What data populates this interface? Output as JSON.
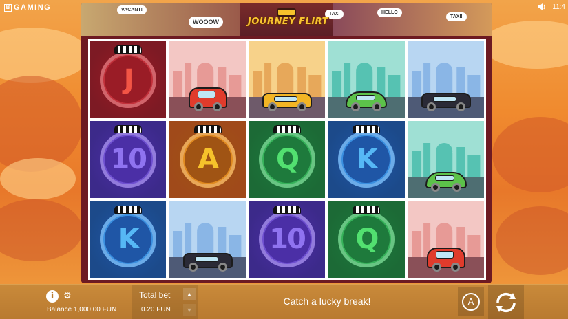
{
  "brand": {
    "name": "GAMING",
    "mark": "B"
  },
  "status": {
    "time": "11:4"
  },
  "game": {
    "title": "JOURNEY FLIRT"
  },
  "header_bubbles": [
    "VACANT!",
    "WOOOW",
    "TAXI",
    "HELLO",
    "TAXI!"
  ],
  "reels": [
    [
      {
        "kind": "letter",
        "label": "J",
        "theme": "red"
      },
      {
        "kind": "vehicle",
        "label": "tuk-tuk",
        "theme": "pink"
      },
      {
        "kind": "vehicle",
        "label": "yellow-cab",
        "theme": "orange"
      },
      {
        "kind": "vehicle",
        "label": "green-beetle",
        "theme": "teal"
      },
      {
        "kind": "vehicle",
        "label": "black-cab",
        "theme": "blue"
      }
    ],
    [
      {
        "kind": "letter",
        "label": "10",
        "theme": "purple"
      },
      {
        "kind": "letter",
        "label": "A",
        "theme": "orange"
      },
      {
        "kind": "letter",
        "label": "Q",
        "theme": "green"
      },
      {
        "kind": "letter",
        "label": "K",
        "theme": "blue"
      },
      {
        "kind": "vehicle",
        "label": "green-beetle",
        "theme": "teal"
      }
    ],
    [
      {
        "kind": "letter",
        "label": "K",
        "theme": "blue"
      },
      {
        "kind": "vehicle",
        "label": "black-cab",
        "theme": "blue"
      },
      {
        "kind": "letter",
        "label": "10",
        "theme": "purple"
      },
      {
        "kind": "letter",
        "label": "Q",
        "theme": "green"
      },
      {
        "kind": "vehicle",
        "label": "tuk-tuk",
        "theme": "pink"
      }
    ]
  ],
  "themes": {
    "red": {
      "bg": "#7d1a24",
      "ring": "#c2303a",
      "inner": "#9a1c26",
      "glyph": "#f35545"
    },
    "purple": {
      "bg": "#3c2a8a",
      "ring": "#6e4fd0",
      "inner": "#4b2fa6",
      "glyph": "#8f73f0"
    },
    "orange": {
      "bg": "#a04a1a",
      "ring": "#e08a20",
      "inner": "#a05414",
      "glyph": "#f6c22b"
    },
    "green": {
      "bg": "#1c6a36",
      "ring": "#36b25a",
      "inner": "#1e7a3c",
      "glyph": "#52e070"
    },
    "blue": {
      "bg": "#1c4a8a",
      "ring": "#3a8fe0",
      "inner": "#1f56a6",
      "glyph": "#56b8f5"
    }
  },
  "vehicle_scenes": {
    "pink": {
      "sky": "#f3c7c4",
      "city": "#e79a96",
      "road": "#8a5058",
      "car": "#e03b2c",
      "roof": "#f6c22b"
    },
    "orange": {
      "sky": "#f7d28a",
      "city": "#e7a85a",
      "road": "#6e5a6a",
      "car": "#f2b524",
      "roof": "#f2b524"
    },
    "teal": {
      "sky": "#9fe0d4",
      "city": "#56c2b2",
      "road": "#4e6e72",
      "car": "#5cc24a",
      "roof": "#5cc24a"
    },
    "blue": {
      "sky": "#b8d6f2",
      "city": "#8ab6e6",
      "road": "#4e5a76",
      "car": "#2a2a36",
      "roof": "#2a2a36"
    }
  },
  "bottom": {
    "info_label": "i",
    "gear_label": "⚙",
    "balance_label": "Balance",
    "balance_value": "1,000.00",
    "balance_currency": "FUN",
    "bet_title": "Total bet",
    "bet_value": "0.20 FUN",
    "message": "Catch a lucky break!",
    "auto_label": "A"
  },
  "colors": {
    "bar": "#c08434",
    "frame": "#6d1a22"
  }
}
